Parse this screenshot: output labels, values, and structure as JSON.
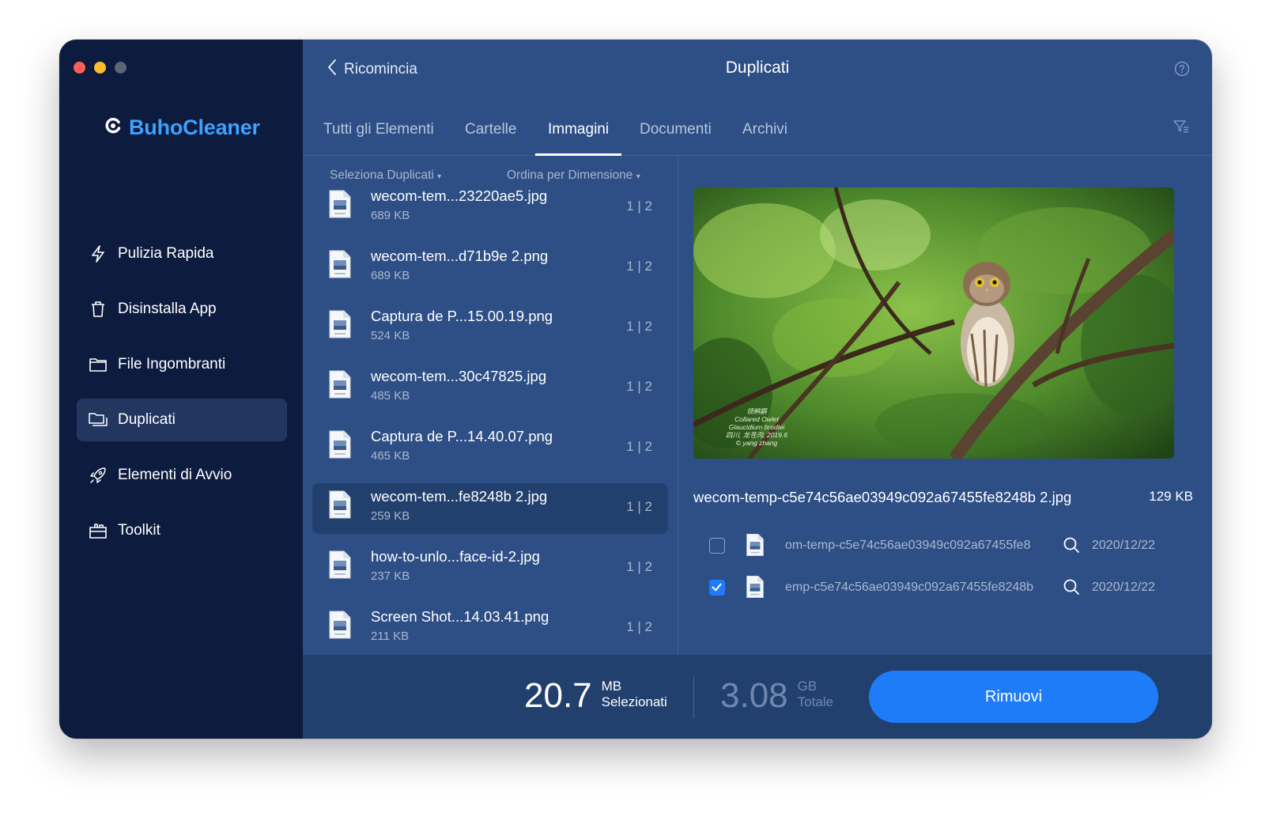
{
  "app": {
    "name": "BuhoCleaner"
  },
  "sidebar": {
    "items": [
      {
        "label": "Pulizia Rapida",
        "icon": "bolt-icon"
      },
      {
        "label": "Disinstalla App",
        "icon": "trash-icon"
      },
      {
        "label": "File Ingombranti",
        "icon": "folder-icon"
      },
      {
        "label": "Duplicati",
        "icon": "duplicate-folders-icon",
        "active": true
      },
      {
        "label": "Elementi di Avvio",
        "icon": "rocket-icon"
      },
      {
        "label": "Toolkit",
        "icon": "toolbox-icon"
      }
    ]
  },
  "header": {
    "back_label": "Ricomincia",
    "title": "Duplicati"
  },
  "tabs": [
    {
      "label": "Tutti gli Elementi"
    },
    {
      "label": "Cartelle"
    },
    {
      "label": "Immagini",
      "active": true
    },
    {
      "label": "Documenti"
    },
    {
      "label": "Archivi"
    }
  ],
  "list": {
    "select_label": "Seleziona Duplicati",
    "sort_label": "Ordina per Dimensione",
    "rows": [
      {
        "name": "wecom-tem...23220ae5.jpg",
        "size": "689 KB",
        "count": "1 | 2"
      },
      {
        "name": "wecom-tem...d71b9e 2.png",
        "size": "689 KB",
        "count": "1 | 2"
      },
      {
        "name": "Captura de P...15.00.19.png",
        "size": "524 KB",
        "count": "1 | 2"
      },
      {
        "name": "wecom-tem...30c47825.jpg",
        "size": "485 KB",
        "count": "1 | 2"
      },
      {
        "name": "Captura de P...14.40.07.png",
        "size": "465 KB",
        "count": "1 | 2"
      },
      {
        "name": "wecom-tem...fe8248b 2.jpg",
        "size": "259 KB",
        "count": "1 | 2",
        "active": true
      },
      {
        "name": "how-to-unlo...face-id-2.jpg",
        "size": "237 KB",
        "count": "1 | 2"
      },
      {
        "name": "Screen Shot...14.03.41.png",
        "size": "211 KB",
        "count": "1 | 2"
      }
    ]
  },
  "preview": {
    "filename": "wecom-temp-c5e74c56ae03949c092a67455fe8248b 2.jpg",
    "size": "129 KB",
    "caption": [
      "领鸺鹠",
      "Collared Owlet",
      "Glaucidium brodiei",
      "四川, 龙苍沟, 2019.6",
      "© yang zhang"
    ],
    "duplicates": [
      {
        "path": "om-temp-c5e74c56ae03949c092a67455fe8",
        "date": "2020/12/22",
        "checked": false
      },
      {
        "path": "emp-c5e74c56ae03949c092a67455fe8248b",
        "date": "2020/12/22",
        "checked": true
      }
    ]
  },
  "footer": {
    "selected_value": "20.7",
    "selected_unit": "MB",
    "selected_label": "Selezionati",
    "total_value": "3.08",
    "total_unit": "GB",
    "total_label": "Totale",
    "remove_label": "Rimuovi"
  },
  "colors": {
    "sidebar_bg": "#0d1b3f",
    "main_bg": "#2e4f86",
    "accent": "#1f7cf8",
    "logo": "#3ea1ff"
  }
}
